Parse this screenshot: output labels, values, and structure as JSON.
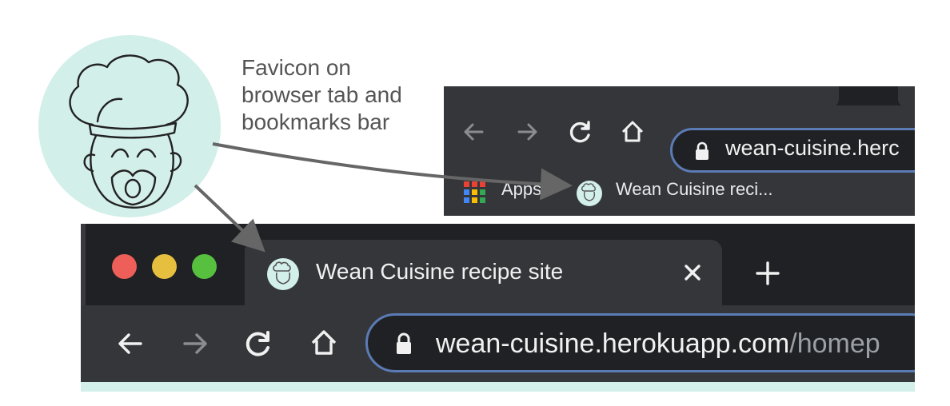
{
  "annotation": {
    "callout_text": "Favicon on\nbrowser tab and\nbookmarks bar"
  },
  "small_browser": {
    "url_visible": "wean-cuisine.herc",
    "bookmarks": {
      "apps_label": "Apps",
      "site_label": "Wean Cuisine reci..."
    }
  },
  "main_browser": {
    "tab_title": "Wean Cuisine recipe site",
    "url_host": "wean-cuisine.herokuapp.com",
    "url_path": "/homep"
  },
  "colors": {
    "favicon_background": "#d3efea",
    "browser_dark": "#202124",
    "browser_toolbar": "#35363a",
    "omnibox_border": "#5b7bb5",
    "traffic_close": "#ed5f58",
    "traffic_minimize": "#e7bf3f",
    "traffic_zoom": "#57c13f",
    "arrow": "#666666"
  },
  "icons": {
    "favicon": "chef-hat-face-icon",
    "back": "arrow-left-icon",
    "forward": "arrow-right-icon",
    "reload": "reload-icon",
    "home": "home-icon",
    "lock": "lock-icon",
    "tab_close": "close-icon",
    "new_tab": "plus-icon",
    "apps": "apps-grid-icon"
  }
}
